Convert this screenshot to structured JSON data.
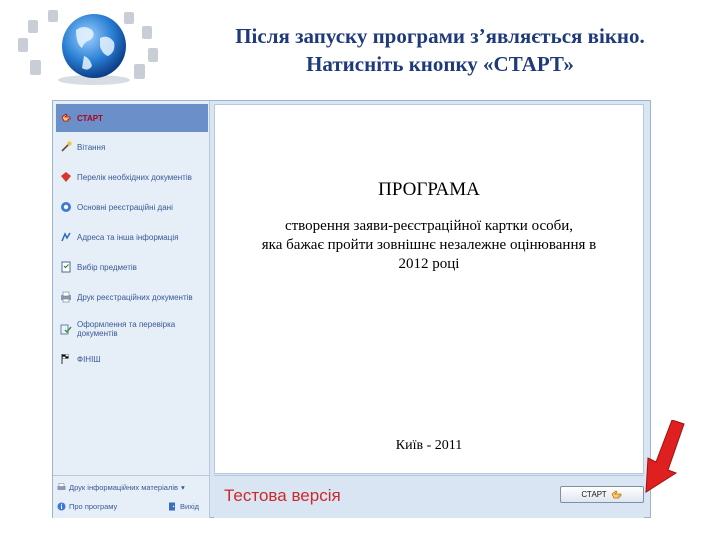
{
  "slide": {
    "title_line1": "Після запуску програми з’являється вікно.",
    "title_line2": "Натисніть кнопку «СТАРТ»"
  },
  "sidebar": {
    "items": [
      {
        "label": "СТАРТ",
        "icon": "hand-pointer-icon"
      },
      {
        "label": "Вітання",
        "icon": "wand-icon"
      },
      {
        "label": "Перелік необхідних документів",
        "icon": "documents-icon"
      },
      {
        "label": "Основні реєстраційні дані",
        "icon": "user-info-icon"
      },
      {
        "label": "Адреса та інша інформація",
        "icon": "address-icon"
      },
      {
        "label": "Вибір предметів",
        "icon": "checklist-icon"
      },
      {
        "label": "Друк реєстраційних документів",
        "icon": "printer-icon"
      },
      {
        "label": "Оформлення та перевірка документів",
        "icon": "docs-check-icon"
      },
      {
        "label": "ФІНІШ",
        "icon": "finish-flag-icon"
      }
    ]
  },
  "main": {
    "heading": "ПРОГРАМА",
    "desc_line1": "створення заяви-реєстраційної картки особи,",
    "desc_line2": "яка бажає пройти зовнішнє незалежне оцінювання в",
    "desc_line3": "2012 році",
    "footer": "Київ - 2011"
  },
  "bottom": {
    "info_materials": "Друк інформаційних матеріалів",
    "about": "Про програму",
    "exit": "Вихід",
    "test_version": "Тестова версія",
    "start_button": "СТАРТ"
  },
  "colors": {
    "title": "#1f3a7a",
    "sidebar_bg": "#e6eef8",
    "window_bg": "#d9e5f2",
    "active_item": "#6a8fc9",
    "test_version": "#cc2a2a",
    "arrow": "#e02020"
  }
}
